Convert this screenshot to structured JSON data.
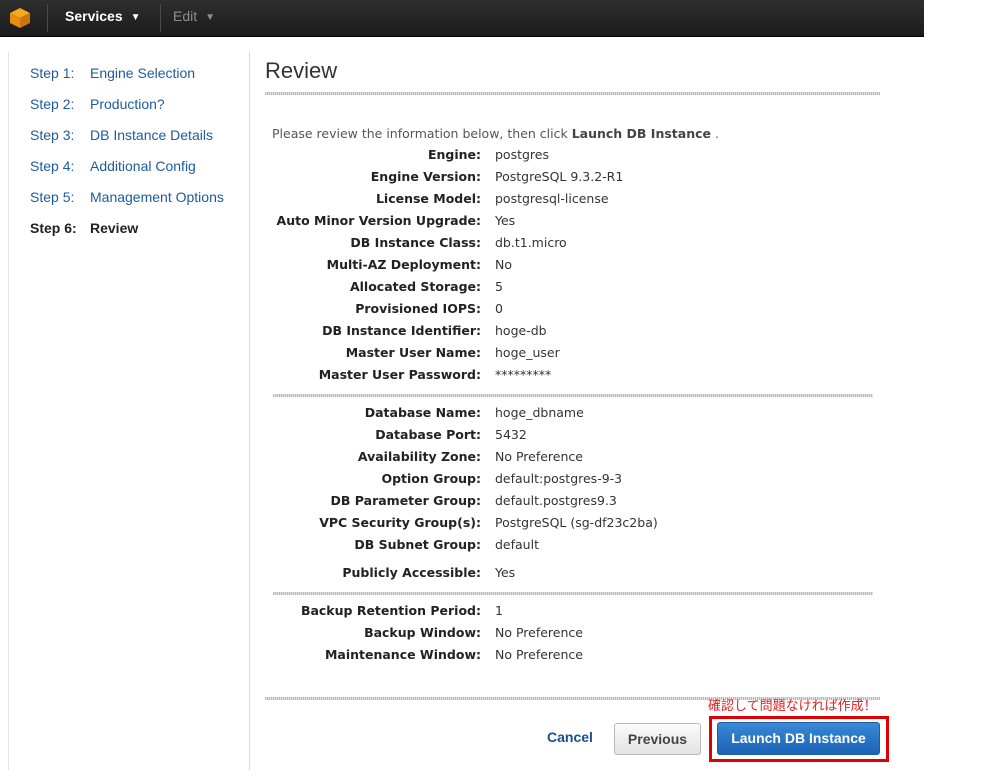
{
  "nav": {
    "services": "Services",
    "edit": "Edit"
  },
  "steps": [
    {
      "num": "Step 1:",
      "label": "Engine Selection"
    },
    {
      "num": "Step 2:",
      "label": "Production?"
    },
    {
      "num": "Step 3:",
      "label": "DB Instance Details"
    },
    {
      "num": "Step 4:",
      "label": "Additional Config"
    },
    {
      "num": "Step 5:",
      "label": "Management Options"
    },
    {
      "num": "Step 6:",
      "label": "Review"
    }
  ],
  "page": {
    "title": "Review",
    "intro_prefix": "Please review the information below, then click ",
    "intro_bold": "Launch DB Instance",
    "intro_suffix": " ."
  },
  "section1": [
    {
      "label": "Engine:",
      "value": "postgres"
    },
    {
      "label": "Engine Version:",
      "value": "PostgreSQL 9.3.2-R1"
    },
    {
      "label": "License Model:",
      "value": "postgresql-license"
    },
    {
      "label": "Auto Minor Version Upgrade:",
      "value": "Yes"
    },
    {
      "label": "DB Instance Class:",
      "value": "db.t1.micro"
    },
    {
      "label": "Multi-AZ Deployment:",
      "value": "No"
    },
    {
      "label": "Allocated Storage:",
      "value": "5"
    },
    {
      "label": "Provisioned IOPS:",
      "value": "0"
    },
    {
      "label": "DB Instance Identifier:",
      "value": "hoge-db"
    },
    {
      "label": "Master User Name:",
      "value": "hoge_user"
    },
    {
      "label": "Master User Password:",
      "value": "*********"
    }
  ],
  "section2": [
    {
      "label": "Database Name:",
      "value": "hoge_dbname"
    },
    {
      "label": "Database Port:",
      "value": "5432"
    },
    {
      "label": "Availability Zone:",
      "value": "No Preference"
    },
    {
      "label": "Option Group:",
      "value": "default:postgres-9-3"
    },
    {
      "label": "DB Parameter Group:",
      "value": "default.postgres9.3"
    },
    {
      "label": "VPC Security Group(s):",
      "value": "PostgreSQL (sg-df23c2ba)"
    },
    {
      "label": "DB Subnet Group:",
      "value": "default"
    },
    {
      "label": "Publicly Accessible:",
      "value": "Yes"
    }
  ],
  "section3": [
    {
      "label": "Backup Retention Period:",
      "value": "1"
    },
    {
      "label": "Backup Window:",
      "value": "No Preference"
    },
    {
      "label": "Maintenance Window:",
      "value": "No Preference"
    }
  ],
  "footer": {
    "annotation": "確認して問題なければ作成！",
    "cancel": "Cancel",
    "previous": "Previous",
    "launch": "Launch DB Instance"
  }
}
